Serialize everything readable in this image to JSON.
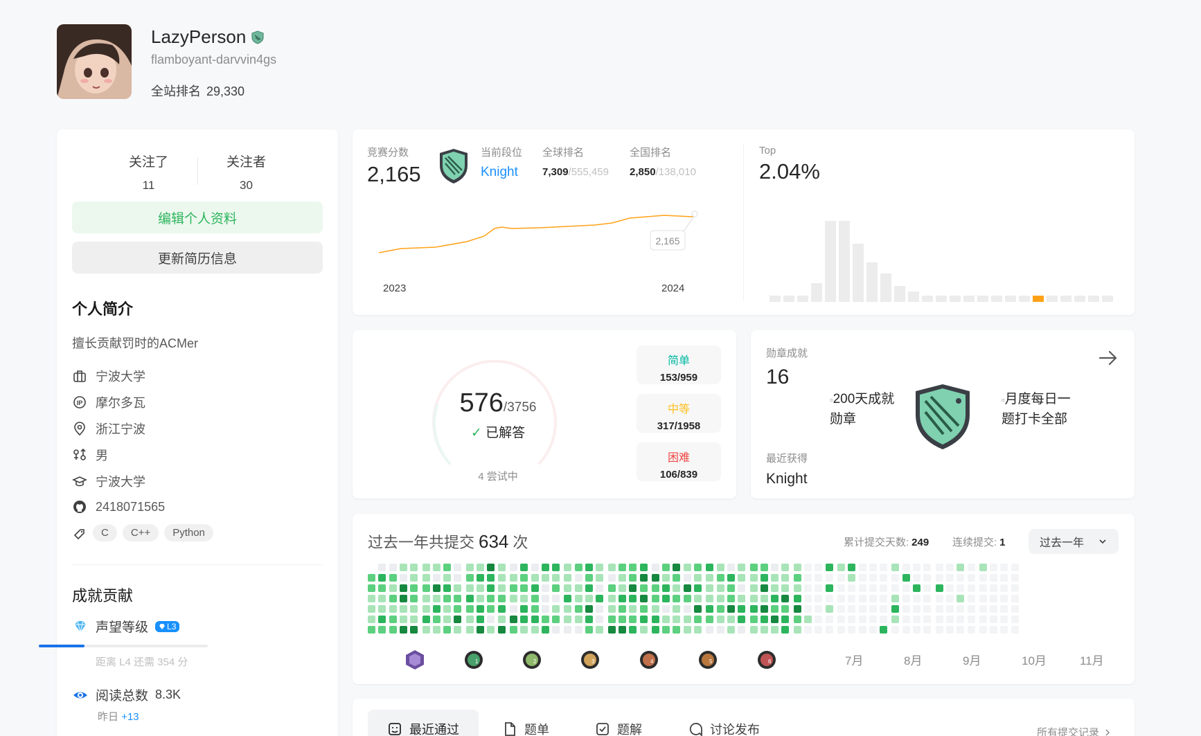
{
  "profile": {
    "name": "LazyPerson",
    "handle": "flamboyant-darvvin4gs",
    "rank_label": "全站排名",
    "rank_value": "29,330"
  },
  "follow": {
    "following_label": "关注了",
    "following_count": "11",
    "followers_label": "关注者",
    "followers_count": "30"
  },
  "buttons": {
    "edit_profile": "编辑个人资料",
    "update_resume": "更新简历信息"
  },
  "bio": {
    "title": "个人简介",
    "text": "擅长贡献罚时的ACMer",
    "items": [
      {
        "icon": "briefcase-icon",
        "text": "宁波大学"
      },
      {
        "icon": "ip-icon",
        "text": "摩尔多瓦"
      },
      {
        "icon": "location-icon",
        "text": "浙江宁波"
      },
      {
        "icon": "gender-icon",
        "text": "男"
      },
      {
        "icon": "graduation-cap-icon",
        "text": "宁波大学"
      },
      {
        "icon": "github-icon",
        "text": "2418071565"
      }
    ],
    "skills": [
      "C",
      "C++",
      "Python"
    ]
  },
  "achievements": {
    "title": "成就贡献",
    "reputation_label": "声望等级",
    "reputation_level": "L3",
    "reputation_progress": 0.27,
    "reputation_note": "距离 L4 还需 354 分",
    "reads_label": "阅读总数",
    "reads_value": "8.3K",
    "yesterday_label": "昨日",
    "yesterday_value": "+13"
  },
  "contest": {
    "score_label": "竞赛分数",
    "score": "2,165",
    "tier_label": "当前段位",
    "tier": "Knight",
    "global_label": "全球排名",
    "global_rank": "7,309",
    "global_total": "/555,459",
    "national_label": "全国排名",
    "national_rank": "2,850",
    "national_total": "/138,010",
    "tooltip": "2,165",
    "x_start": "2023",
    "x_end": "2024",
    "top_label": "Top",
    "top_value": "2.04%",
    "accent": "#ffa116"
  },
  "solved": {
    "count": "576",
    "total": "/3756",
    "status": "已解答",
    "attempting": "4 尝试中",
    "easy_label": "简单",
    "easy_value": "153/959",
    "medium_label": "中等",
    "medium_value": "317/1958",
    "hard_label": "困难",
    "hard_value": "106/839",
    "easy_color": "#00b8a3",
    "medium_color": "#ffc01e",
    "hard_color": "#ef4743"
  },
  "badges": {
    "title": "勋章成就",
    "count": "16",
    "badge1_alt": "200天成就勋章",
    "badge2_alt": "月度每日一题打卡全部",
    "recent_label": "最近获得",
    "recent_value": "Knight"
  },
  "heatmap": {
    "title_pre": "过去一年共提交",
    "total": "634",
    "title_post": "次",
    "days_label": "累计提交天数:",
    "days_value": "249",
    "streak_label": "连续提交:",
    "streak_value": "1",
    "range": "过去一年",
    "months": [
      "7月",
      "8月",
      "9月",
      "10月",
      "11月"
    ]
  },
  "tabs": {
    "items": [
      "最近通过",
      "题单",
      "题解",
      "讨论发布"
    ],
    "all_link": "所有提交记录"
  }
}
